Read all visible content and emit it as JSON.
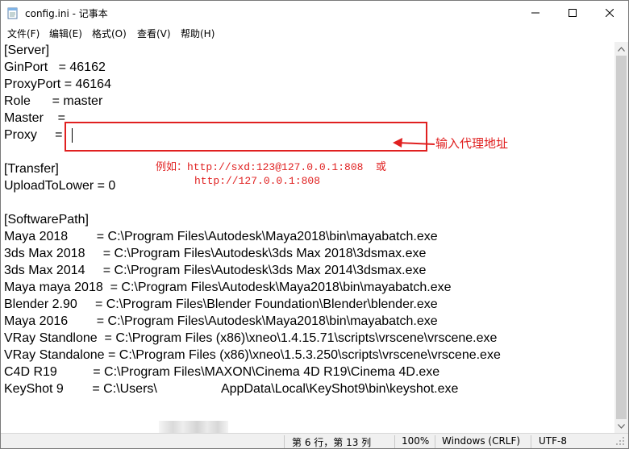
{
  "window": {
    "title": "config.ini - 记事本"
  },
  "menu": [
    {
      "label": "文件(F)"
    },
    {
      "label": "编辑(E)"
    },
    {
      "label": "格式(O)"
    },
    {
      "label": "查看(V)"
    },
    {
      "label": "帮助(H)"
    }
  ],
  "editor": {
    "lines": [
      "[Server]",
      "GinPort   = 46162",
      "ProxyPort = 46164",
      "Role      = master",
      "Master    =",
      "Proxy     =",
      "",
      "[Transfer]",
      "UploadToLower = 0",
      "",
      "[SoftwarePath]",
      "Maya 2018        = C:\\Program Files\\Autodesk\\Maya2018\\bin\\mayabatch.exe",
      "3ds Max 2018     = C:\\Program Files\\Autodesk\\3ds Max 2018\\3dsmax.exe",
      "3ds Max 2014     = C:\\Program Files\\Autodesk\\3ds Max 2014\\3dsmax.exe",
      "Maya maya 2018  = C:\\Program Files\\Autodesk\\Maya2018\\bin\\mayabatch.exe",
      "Blender 2.90     = C:\\Program Files\\Blender Foundation\\Blender\\blender.exe",
      "Maya 2016        = C:\\Program Files\\Autodesk\\Maya2018\\bin\\mayabatch.exe",
      "VRay Standlone  = C:\\Program Files (x86)\\xneo\\1.4.15.71\\scripts\\vrscene\\vrscene.exe",
      "VRay Standalone = C:\\Program Files (x86)\\xneo\\1.5.3.250\\scripts\\vrscene\\vrscene.exe",
      "C4D R19          = C:\\Program Files\\MAXON\\Cinema 4D R19\\Cinema 4D.exe",
      "KeyShot 9        = C:\\Users\\                  AppData\\Local\\KeyShot9\\bin\\keyshot.exe"
    ]
  },
  "annotation": {
    "label": "输入代理地址",
    "example_line1": "例如：http://sxd:123@127.0.0.1:808  或",
    "example_line2": "http://127.0.0.1:808",
    "color": "#e02020"
  },
  "status": {
    "position": "第 6 行，第 13 列",
    "zoom": "100%",
    "line_ending": "Windows (CRLF)",
    "encoding": "UTF-8"
  }
}
